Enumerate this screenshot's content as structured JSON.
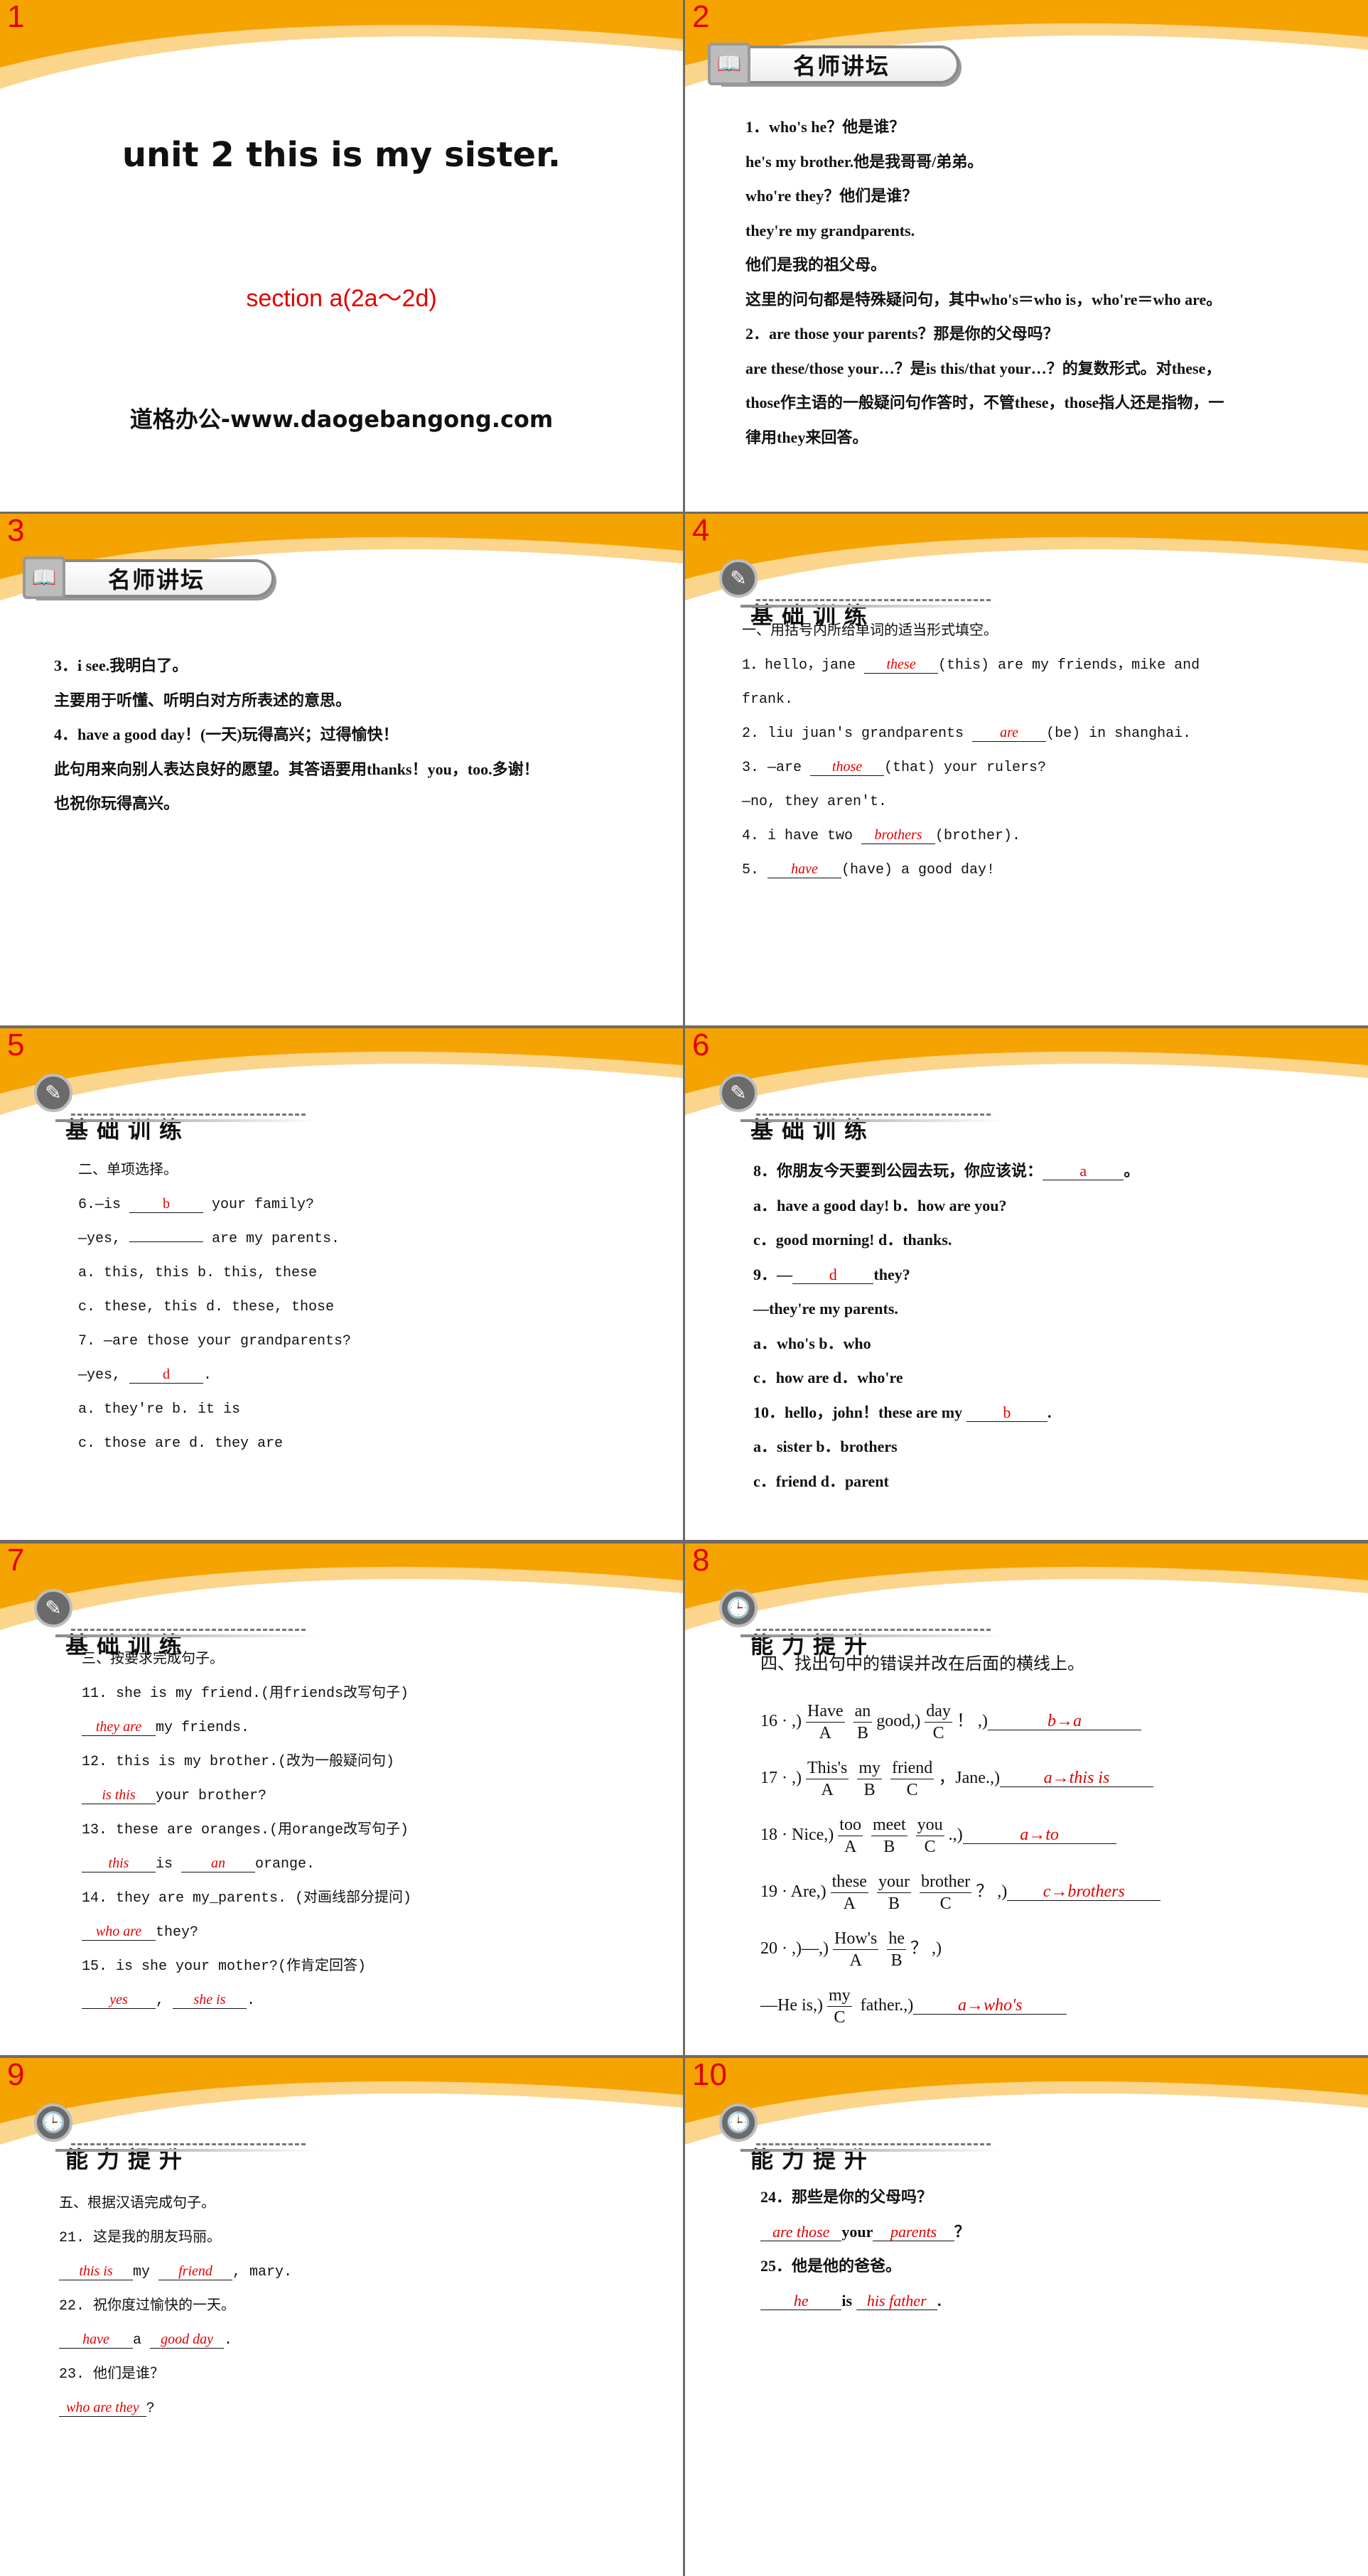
{
  "colors": {
    "header_orange": "#f5a300",
    "header_light": "#fbd58c",
    "answer_red": "#e00000",
    "slide_number_red": "#e00000",
    "grid_gray": "#6f6a66"
  },
  "slide1": {
    "num": "1",
    "title": "unit 2  this is my sister.",
    "subtitle": "section a(2a～2d)",
    "url": "道格办公-www.daogebangong.com"
  },
  "slides": [
    {
      "num": "2",
      "badge": {
        "label": "名师讲坛",
        "icon": "book-icon",
        "style": "pill"
      },
      "font": "serif",
      "lines": [
        [
          "1．who's he？他是谁？"
        ],
        [
          "he's my brother.他是我哥哥/弟弟。"
        ],
        [
          "who're they？他们是谁？"
        ],
        [
          "they're my grandparents."
        ],
        [
          "他们是我的祖父母。"
        ],
        [
          "这里的问句都是特殊疑问句，其中who's＝who is，who're＝who are。"
        ],
        [
          "2．are those your parents？那是你的父母吗？"
        ],
        [
          "are these/those your…？是is this/that your…？的复数形式。对these，"
        ],
        [
          "those作主语的一般疑问句作答时，不管these，those指人还是指物，一"
        ],
        [
          "律用they来回答。"
        ]
      ]
    },
    {
      "num": "3",
      "badge": {
        "label": "名师讲坛",
        "icon": "book-icon",
        "style": "pill"
      },
      "font": "serif",
      "lines": [
        [
          "3．i see.我明白了。"
        ],
        [
          "主要用于听懂、听明白对方所表述的意思。"
        ],
        [
          "4．have a good day！(一天)玩得高兴；过得愉快！"
        ],
        [
          "此句用来向别人表达良好的愿望。其答语要用thanks！you，too.多谢！"
        ],
        [
          "也祝你玩得高兴。"
        ]
      ]
    },
    {
      "num": "4",
      "badge": {
        "label": "基础训练",
        "icon": "pencil-icon",
        "style": "line"
      },
      "font": "mono",
      "lines": [
        [
          "一、用括号内所给单词的适当形式填空。"
        ],
        [
          "1．hello，jane ",
          {
            "a": "these"
          },
          "(this) are my friends，mike and"
        ],
        [
          "frank."
        ],
        [
          "2. liu juan's grandparents ",
          {
            "a": "are"
          },
          "(be) in shanghai."
        ],
        [
          "3. —are ",
          {
            "a": "those"
          },
          "(that) your rulers?"
        ],
        [
          "—no, they aren't."
        ],
        [
          "4. i have two ",
          {
            "a": "brothers"
          },
          "(brother)."
        ],
        [
          "5. ",
          {
            "a": "have"
          },
          "(have) a good day!"
        ]
      ]
    },
    {
      "num": "5",
      "badge": {
        "label": "基础训练",
        "icon": "pencil-icon",
        "style": "line"
      },
      "font": "mono",
      "plain": true,
      "lines": [
        [
          "二、单项选择。"
        ],
        [
          "6.—is ",
          {
            "a": "b"
          },
          " your family?"
        ],
        [
          "—yes, ",
          {
            "a": ""
          },
          " are my parents."
        ],
        [
          "a. this, this        b. this, these"
        ],
        [
          "c. these, this  d. these, those"
        ],
        [
          "7. —are those your grandparents?"
        ],
        [
          "—yes, ",
          {
            "a": "d"
          },
          "."
        ],
        [
          "a. they're  b. it is"
        ],
        [
          "c. those are  d. they are"
        ]
      ]
    },
    {
      "num": "6",
      "badge": {
        "label": "基础训练",
        "icon": "pencil-icon",
        "style": "line"
      },
      "font": "serif",
      "plain": true,
      "lines": [
        [
          "8．你朋友今天要到公园去玩，你应该说：",
          {
            "a": "a"
          },
          "。"
        ],
        [
          "a．have a good day!    b．how are you?"
        ],
        [
          "c．good morning!    d．thanks."
        ],
        [
          "9．—",
          {
            "a": "d"
          },
          "they?"
        ],
        [
          "—they're my parents."
        ],
        [
          "a．who's  b．who"
        ],
        [
          "c．how are  d．who're"
        ],
        [
          "10．hello，john！these are my ",
          {
            "a": "b"
          },
          "."
        ],
        [
          "a．sister  b．brothers"
        ],
        [
          "c．friend  d．parent"
        ]
      ]
    },
    {
      "num": "7",
      "badge": {
        "label": "基础训练",
        "icon": "pencil-icon",
        "style": "line"
      },
      "font": "mono",
      "lines": [
        [
          "三、按要求完成句子。"
        ],
        [
          "11. she is my friend.(用friends改写句子)"
        ],
        [
          {
            "a": "they are"
          },
          "my friends."
        ],
        [
          "12. this is my brother.(改为一般疑问句)"
        ],
        [
          {
            "a": "is this"
          },
          "your brother?"
        ],
        [
          "13. these are oranges.(用orange改写句子)"
        ],
        [
          {
            "a": "this"
          },
          "is ",
          {
            "a": "an"
          },
          "orange."
        ],
        [
          "14. they are my_parents. (对画线部分提问)"
        ],
        [
          {
            "a": "who are"
          },
          "they?"
        ],
        [
          "15. is she your mother?(作肯定回答)"
        ],
        [
          {
            "a": "yes"
          },
          ", ",
          {
            "a": "she is"
          },
          "."
        ]
      ]
    },
    {
      "num": "8",
      "badge": {
        "label": "能力提升",
        "icon": "clock-icon",
        "style": "line"
      },
      "font": "serif",
      "lines": [
        [
          "四、找出句中的错误并改在后面的横线上。"
        ],
        [
          "16 · ,)",
          {
            "w": "Have",
            "l": "A"
          },
          {
            "w": "an",
            "l": "B"
          },
          "good,)",
          {
            "w": "day",
            "l": "C"
          },
          "！ ,)",
          {
            "a": "b→a"
          }
        ],
        [
          "17 · ,)",
          {
            "w": "This's",
            "l": "A"
          },
          {
            "w": "my",
            "l": "B"
          },
          {
            "w": "friend",
            "l": "C"
          },
          "，Jane.,)",
          {
            "a": "a→this  is"
          }
        ],
        [
          "18 · Nice,)",
          {
            "w": "too",
            "l": "A"
          },
          {
            "w": "meet",
            "l": "B"
          },
          {
            "w": "you",
            "l": "C"
          },
          ".,)",
          {
            "a": "a→to"
          }
        ],
        [
          "19 · Are,)",
          {
            "w": "these",
            "l": "A"
          },
          {
            "w": "your",
            "l": "B"
          },
          {
            "w": "brother",
            "l": "C"
          },
          "？ ,)",
          {
            "a": "c→brothers"
          }
        ],
        [
          "20 · ,)—,)",
          {
            "w": "How's",
            "l": "A"
          },
          {
            "w": "he",
            "l": "B"
          },
          "？ ,)"
        ],
        [
          "—He is,)",
          {
            "w": "my",
            "l": "C"
          },
          " father.,)",
          {
            "a": "a→who's"
          }
        ]
      ]
    },
    {
      "num": "9",
      "badge": {
        "label": "能力提升",
        "icon": "clock-icon",
        "style": "line"
      },
      "font": "mono",
      "lines": [
        [
          "五、根据汉语完成句子。"
        ],
        [
          "21. 这是我的朋友玛丽。"
        ],
        [
          {
            "a": "this is"
          },
          "my ",
          {
            "a": "friend"
          },
          ", mary."
        ],
        [
          "22. 祝你度过愉快的一天。"
        ],
        [
          {
            "a": "have"
          },
          "a ",
          {
            "a": "good day"
          },
          "."
        ],
        [
          "23. 他们是谁？"
        ],
        [
          {
            "a": "who are they"
          },
          "?"
        ]
      ]
    },
    {
      "num": "10",
      "badge": {
        "label": "能力提升",
        "icon": "clock-icon",
        "style": "line"
      },
      "font": "serif",
      "lines": [
        [
          "24．那些是你的父母吗？"
        ],
        [
          {
            "a": "are those"
          },
          "your",
          {
            "a": "parents"
          },
          "？"
        ],
        [
          "25．他是他的爸爸。"
        ],
        [
          {
            "a": "he"
          },
          "is ",
          {
            "a": "his father"
          },
          "."
        ]
      ]
    }
  ]
}
